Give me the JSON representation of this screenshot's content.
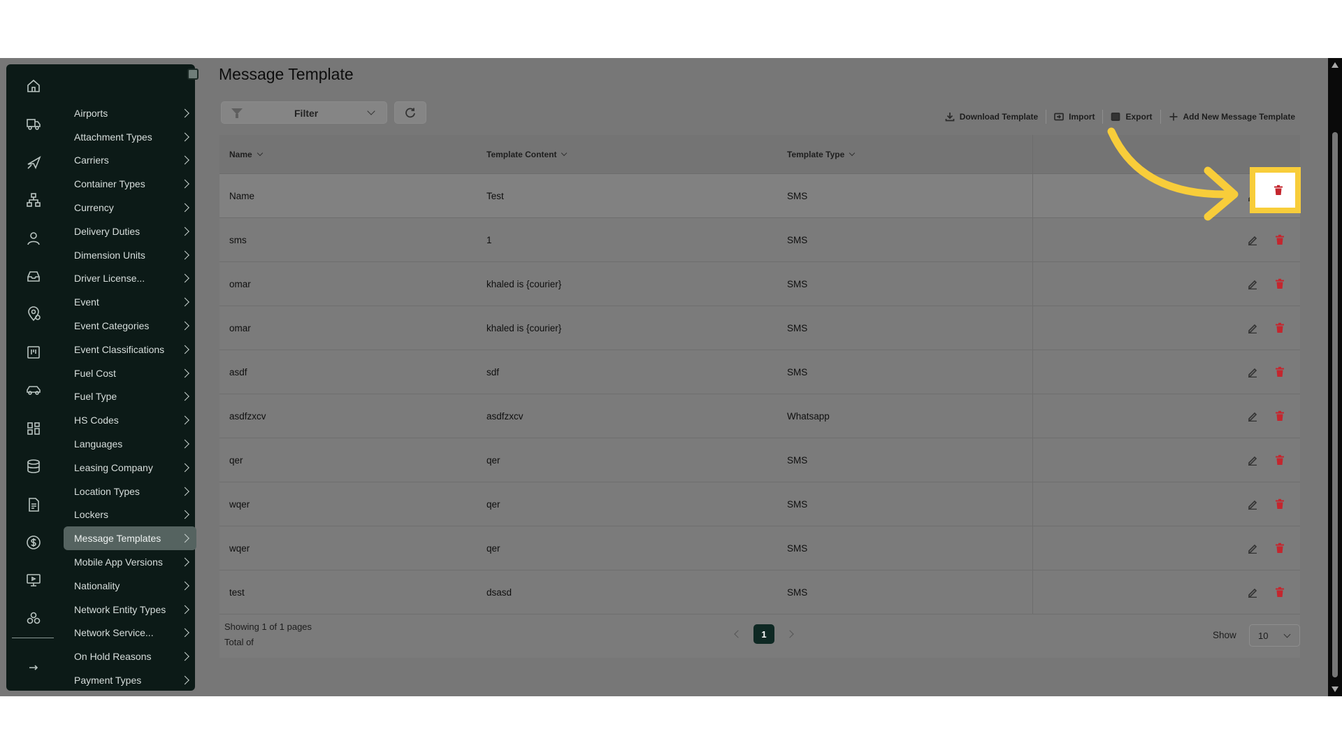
{
  "page": {
    "title": "Message Template"
  },
  "sidebar": {
    "menu_items": [
      "Airports",
      "Attachment Types",
      "Carriers",
      "Container Types",
      "Currency",
      "Delivery Duties",
      "Dimension Units",
      "Driver License...",
      "Event",
      "Event Categories",
      "Event Classifications",
      "Fuel Cost",
      "Fuel Type",
      "HS Codes",
      "Languages",
      "Leasing Company",
      "Location Types",
      "Lockers",
      "Message Templates",
      "Mobile App Versions",
      "Nationality",
      "Network Entity Types",
      "Network Service...",
      "On Hold Reasons",
      "Payment Types"
    ],
    "active_item": "Message Templates",
    "rail_icons": [
      "home-icon",
      "truck-icon",
      "plane-icon",
      "sitemap-icon",
      "user-icon",
      "tray-icon",
      "location-pin-icon",
      "board-icon",
      "car-icon",
      "grid-icon",
      "database-icon",
      "document-icon",
      "dollar-icon",
      "monitor-icon",
      "cubes-icon",
      "logout-icon"
    ]
  },
  "filter": {
    "label": "Filter"
  },
  "toolbar": {
    "download_label": "Download Template",
    "import_label": "Import",
    "export_label": "Export",
    "add_label": "Add New Message Template"
  },
  "table": {
    "columns": [
      "Name",
      "Template Content",
      "Template Type"
    ],
    "rows": [
      {
        "name": "Name",
        "content": "Test",
        "type": "SMS"
      },
      {
        "name": "sms",
        "content": "1",
        "type": "SMS"
      },
      {
        "name": "omar",
        "content": "khaled is {courier}",
        "type": "SMS"
      },
      {
        "name": "omar",
        "content": "khaled is {courier}",
        "type": "SMS"
      },
      {
        "name": "asdf",
        "content": "sdf",
        "type": "SMS"
      },
      {
        "name": "asdfzxcv",
        "content": "asdfzxcv",
        "type": "Whatsapp"
      },
      {
        "name": "qer",
        "content": "qer",
        "type": "SMS"
      },
      {
        "name": "wqer",
        "content": "qer",
        "type": "SMS"
      },
      {
        "name": "wqer",
        "content": "qer",
        "type": "SMS"
      },
      {
        "name": "test",
        "content": "dsasd",
        "type": "SMS"
      }
    ]
  },
  "pagination": {
    "showing": "Showing 1 of 1 pages",
    "total": "Total of",
    "current_page": "1",
    "show_label": "Show",
    "page_size": "10"
  },
  "colors": {
    "highlight": "#f8cd3a",
    "delete": "#c4262e",
    "active_page": "#0e2823"
  }
}
